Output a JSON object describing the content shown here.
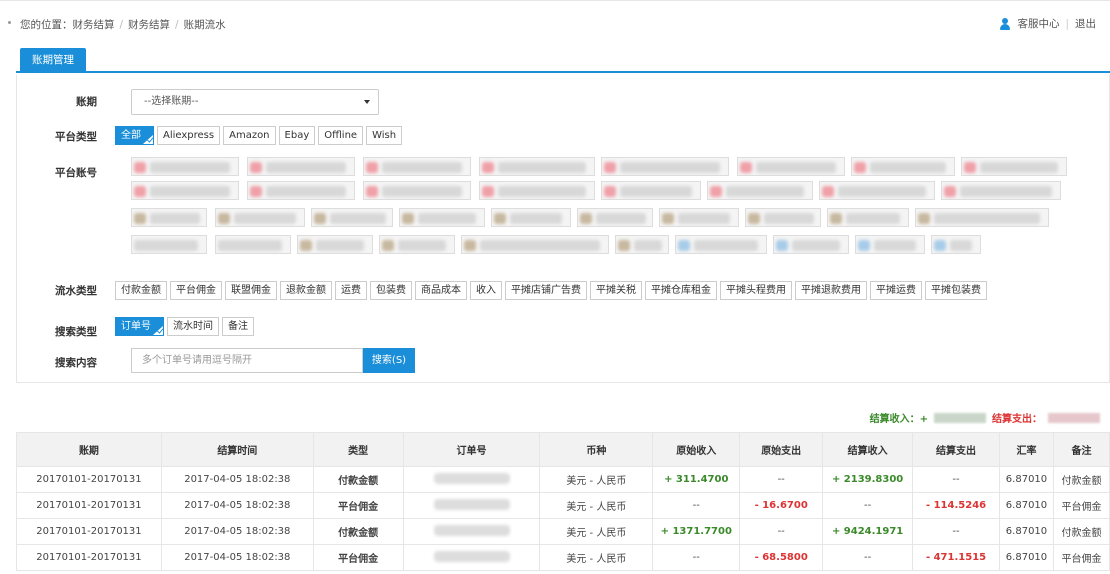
{
  "breadcrumb": {
    "prefix": "您的位置：",
    "items": [
      "财务结算",
      "财务结算",
      "账期流水"
    ]
  },
  "topright": {
    "service": "客服中心",
    "logout": "退出"
  },
  "tab": {
    "label": "账期管理"
  },
  "filters": {
    "period": {
      "label": "账期",
      "placeholder": "--选择账期--"
    },
    "platform": {
      "label": "平台类型",
      "options": [
        "全部",
        "Aliexpress",
        "Amazon",
        "Ebay",
        "Offline",
        "Wish"
      ],
      "selected": "全部"
    },
    "account": {
      "label": "平台账号"
    },
    "flow": {
      "label": "流水类型",
      "options": [
        "付款金额",
        "平台佣金",
        "联盟佣金",
        "退款金额",
        "运费",
        "包装费",
        "商品成本",
        "收入",
        "平摊店铺广告费",
        "平摊关税",
        "平摊仓库租金",
        "平摊头程费用",
        "平摊退款费用",
        "平摊运费",
        "平摊包装费"
      ]
    },
    "searchType": {
      "label": "搜索类型",
      "options": [
        "订单号",
        "流水时间",
        "备注"
      ],
      "selected": "订单号"
    },
    "searchContent": {
      "label": "搜索内容",
      "placeholder": "多个订单号请用逗号隔开",
      "button": "搜索(S)"
    }
  },
  "summary": {
    "income_label": "结算收入：+",
    "expense_label": "结算支出："
  },
  "table": {
    "headers": [
      "账期",
      "结算时间",
      "类型",
      "订单号",
      "币种",
      "原始收入",
      "原始支出",
      "结算收入",
      "结算支出",
      "汇率",
      "备注"
    ],
    "rows": [
      [
        "20170101-20170131",
        "2017-04-05 18:02:38",
        "付款金额",
        "",
        "美元 - 人民币",
        "+ 311.4700",
        "--",
        "+ 2139.8300",
        "--",
        "6.87010",
        "付款金额"
      ],
      [
        "20170101-20170131",
        "2017-04-05 18:02:38",
        "平台佣金",
        "",
        "美元 - 人民币",
        "--",
        "- 16.6700",
        "--",
        "- 114.5246",
        "6.87010",
        "平台佣金"
      ],
      [
        "20170101-20170131",
        "2017-04-05 18:02:38",
        "付款金额",
        "",
        "美元 - 人民币",
        "+ 1371.7700",
        "--",
        "+ 9424.1971",
        "--",
        "6.87010",
        "付款金额"
      ],
      [
        "20170101-20170131",
        "2017-04-05 18:02:38",
        "平台佣金",
        "",
        "美元 - 人民币",
        "--",
        "- 68.5800",
        "--",
        "- 471.1515",
        "6.87010",
        "平台佣金"
      ]
    ]
  }
}
